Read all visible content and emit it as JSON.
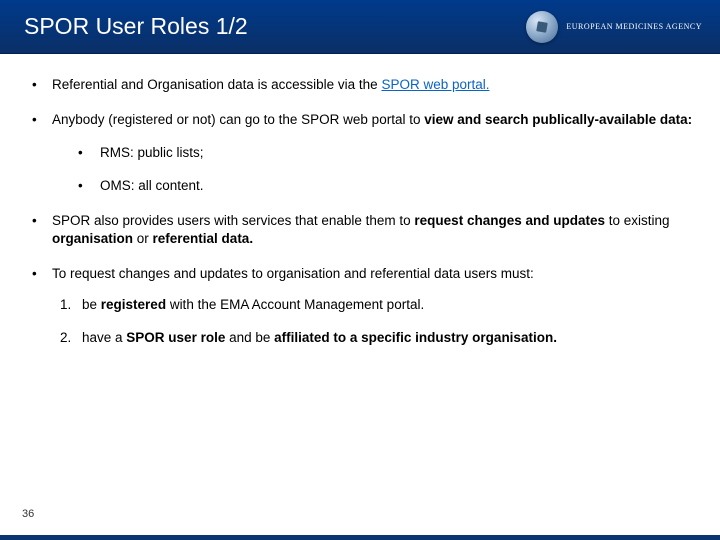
{
  "header": {
    "title": "SPOR User Roles 1/2",
    "agency": "EUROPEAN MEDICINES AGENCY"
  },
  "bullets": {
    "b1_pre": "Referential and Organisation data is accessible via the ",
    "b1_link": "SPOR web portal.",
    "b2_pre": "Anybody (registered or not) ",
    "b2_mid": "can go to the SPOR web portal to ",
    "b2_bold": "view and search publically-available data:",
    "sub1": "RMS: public lists;",
    "sub2": "OMS: all content.",
    "b3_a": "SPOR also provides users with services that enable them to ",
    "b3_b": "request changes and updates",
    "b3_c": " to existing ",
    "b3_d": "organisation",
    "b3_e": " or ",
    "b3_f": "referential data.",
    "b4": "To request changes and updates to organisation and referential data users must:",
    "n1_marker": "1.",
    "n1_a": "be ",
    "n1_b": "registered",
    "n1_c": " with the EMA Account Management portal.",
    "n2_marker": "2.",
    "n2_a": "have a ",
    "n2_b": "SPOR user role",
    "n2_c": " and be ",
    "n2_d": "affiliated to a specific industry organisation."
  },
  "page_number": "36"
}
